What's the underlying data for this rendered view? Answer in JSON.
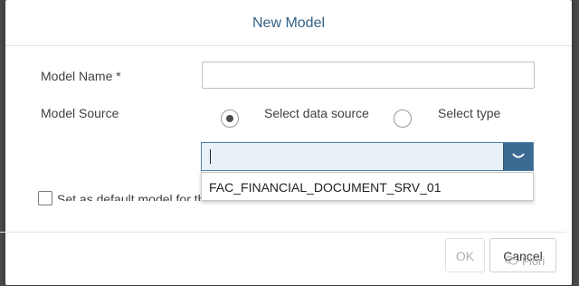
{
  "dialog": {
    "title": "New Model"
  },
  "form": {
    "model_name_label": "Model Name *",
    "model_name_value": "",
    "model_source_label": "Model Source",
    "source_options": [
      {
        "label": "Select data source",
        "selected": true
      },
      {
        "label": "Select type",
        "selected": false
      }
    ],
    "combo_value": "",
    "dropdown_items": [
      "FAC_FINANCIAL_DOCUMENT_SRV_01"
    ],
    "default_checkbox_label": "Set as default model for the application",
    "default_checked": false
  },
  "footer": {
    "ok_label": "OK",
    "cancel_label": "Cancel",
    "ok_enabled": false
  },
  "watermark": {
    "text": "Fiori"
  },
  "colors": {
    "title": "#346187",
    "combo_button": "#3c6a92",
    "combo_fill": "#e8f1f8"
  }
}
